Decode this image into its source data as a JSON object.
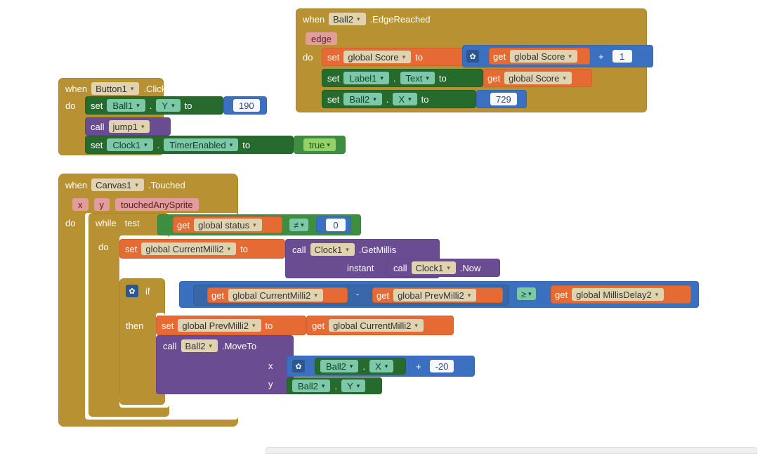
{
  "colors": {
    "mustard": "#b89132",
    "green": "#3e8e41",
    "darkgreen": "#276a2d",
    "purple": "#6a4c93",
    "orange": "#e56a33",
    "blue": "#3b6fbf",
    "teal": "#7dc8a8"
  },
  "block1": {
    "keyword_when": "when",
    "component": "Button1",
    "event": ".Click",
    "keyword_do": "do",
    "set1_keyword": "set",
    "set1_component": "Ball1",
    "set1_dot": ".",
    "set1_prop": "Y",
    "set1_to": "to",
    "set1_value": "190",
    "call_keyword": "call",
    "call_proc": "jump1",
    "set2_keyword": "set",
    "set2_component": "Clock1",
    "set2_dot": ".",
    "set2_prop": "TimerEnabled",
    "set2_to": "to",
    "set2_value": "true"
  },
  "block2": {
    "keyword_when": "when",
    "component": "Ball2",
    "event": ".EdgeReached",
    "param": "edge",
    "keyword_do": "do",
    "setScore": {
      "keyword": "set",
      "var": "global Score",
      "to": "to",
      "get": "get",
      "getvar": "global Score",
      "plus": "+",
      "one": "1"
    },
    "setLabel": {
      "keyword": "set",
      "component": "Label1",
      "prop": "Text",
      "to": "to",
      "get": "get",
      "var": "global Score"
    },
    "setX": {
      "keyword": "set",
      "component": "Ball2",
      "prop": "X",
      "to": "to",
      "value": "729"
    }
  },
  "block3": {
    "keyword_when": "when",
    "component": "Canvas1",
    "event": ".Touched",
    "param_x": "x",
    "param_y": "y",
    "param_tas": "touchedAnySprite",
    "keyword_do": "do",
    "while": {
      "keyword_while": "while",
      "test": "test",
      "get": "get",
      "var": "global status",
      "neq": "≠",
      "zero": "0",
      "keyword_do": "do"
    },
    "setCurrent": {
      "keyword": "set",
      "var": "global CurrentMilli2",
      "to": "to",
      "call": "call",
      "comp": "Clock1",
      "method": ".GetMillis",
      "instant": "instant",
      "call2": "call",
      "comp2": "Clock1",
      "method2": ".Now"
    },
    "if": {
      "keyword_if": "if",
      "get1": "get",
      "var1": "global CurrentMilli2",
      "minus": "-",
      "get2": "get",
      "var2": "global PrevMilli2",
      "gte": "≥",
      "get3": "get",
      "var3": "global MillisDelay2",
      "keyword_then": "then"
    },
    "setPrev": {
      "keyword": "set",
      "var": "global PrevMilli2",
      "to": "to",
      "get": "get",
      "var2": "global CurrentMilli2"
    },
    "moveto": {
      "call": "call",
      "comp": "Ball2",
      "method": ".MoveTo",
      "x": "x",
      "y": "y",
      "ball_x_comp": "Ball2",
      "ball_x_prop": "X",
      "plus": "+",
      "delta": "-20",
      "ball_y_comp": "Ball2",
      "ball_y_prop": "Y"
    }
  },
  "dot": "."
}
